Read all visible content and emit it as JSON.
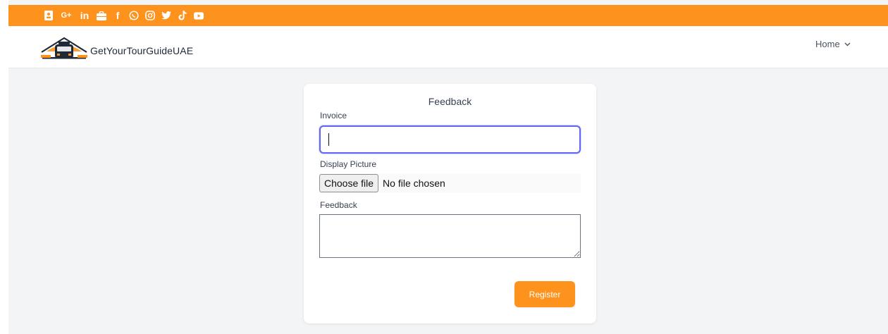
{
  "colors": {
    "accent": "#fd921d",
    "focus": "#6366f1",
    "background": "#f3f4f6"
  },
  "topbar": {
    "social_icons": [
      "contact-card-icon",
      "google-plus-icon",
      "linkedin-icon",
      "briefcase-icon",
      "facebook-icon",
      "whatsapp-icon",
      "instagram-icon",
      "twitter-icon",
      "tiktok-icon",
      "youtube-icon"
    ],
    "google_plus_text": "G+",
    "linkedin_text": "in",
    "facebook_text": "f"
  },
  "header": {
    "brand": "GetYourTourGuideUAE",
    "nav": {
      "home_label": "Home"
    }
  },
  "form": {
    "title": "Feedback",
    "invoice_label": "Invoice",
    "invoice_value": "",
    "display_picture_label": "Display Picture",
    "choose_file_label": "Choose file",
    "file_status": "No file chosen",
    "feedback_label": "Feedback",
    "feedback_value": "",
    "register_label": "Register"
  }
}
